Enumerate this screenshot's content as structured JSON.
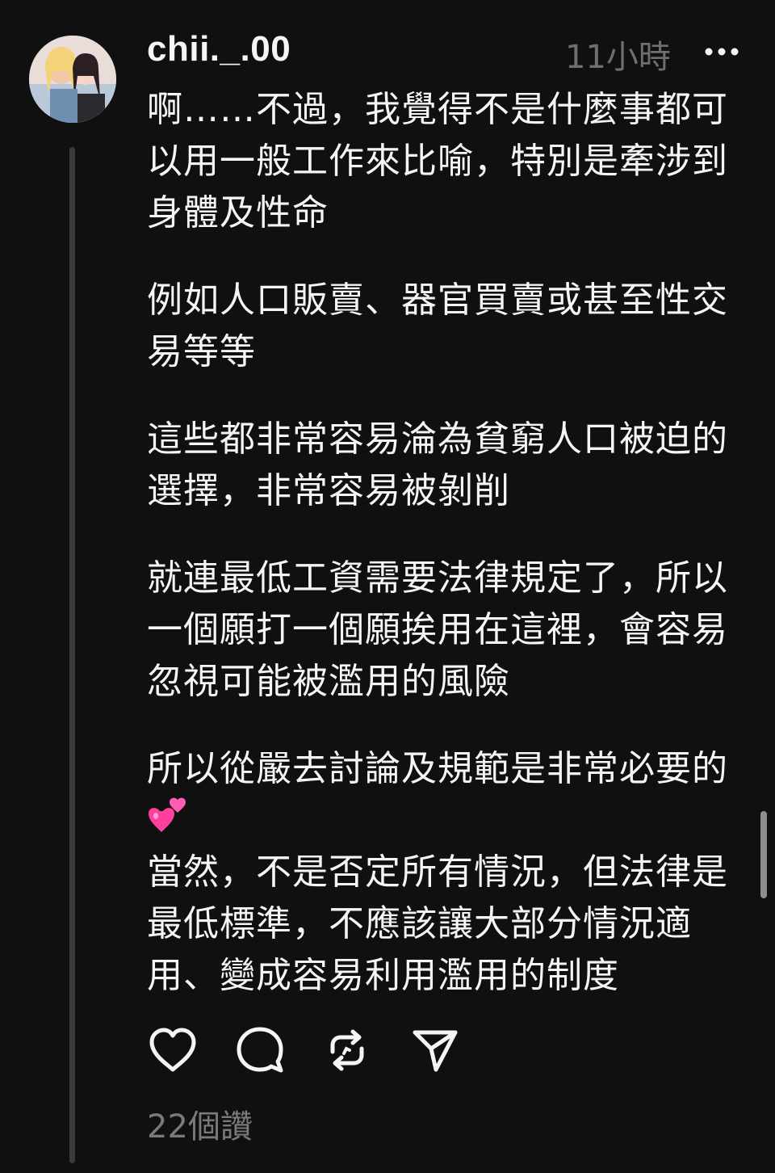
{
  "post": {
    "username": "chii._.00",
    "timestamp": "11小時",
    "paragraphs": [
      "啊……不過，我覺得不是什麼事都可\n以用一般工作來比喻，特別是牽涉到\n身體及性命",
      "例如人口販賣、器官買賣或甚至性交\n易等等",
      "這些都非常容易淪為貧窮人口被迫的\n選擇，非常容易被剝削",
      "就連最低工資需要法律規定了，所以\n一個願打一個願挨用在這裡，會容易\n忽視可能被濫用的風險",
      "所以從嚴去討論及規範是非常必要的",
      "當然，不是否定所有情況，但法律是\n最低標準，不應該讓大部分情況適\n用、變成容易利用濫用的制度"
    ],
    "emoji_icon": "two-hearts",
    "likes": "22個讚"
  },
  "actions": [
    {
      "name": "like",
      "icon": "heart-icon"
    },
    {
      "name": "comment",
      "icon": "comment-icon"
    },
    {
      "name": "repost",
      "icon": "repost-icon"
    },
    {
      "name": "share",
      "icon": "send-icon"
    }
  ],
  "colors": {
    "background": "#101010",
    "text": "#f3f5f7",
    "muted": "#6f6f6f",
    "heart_pink": "#ff4fa8"
  }
}
